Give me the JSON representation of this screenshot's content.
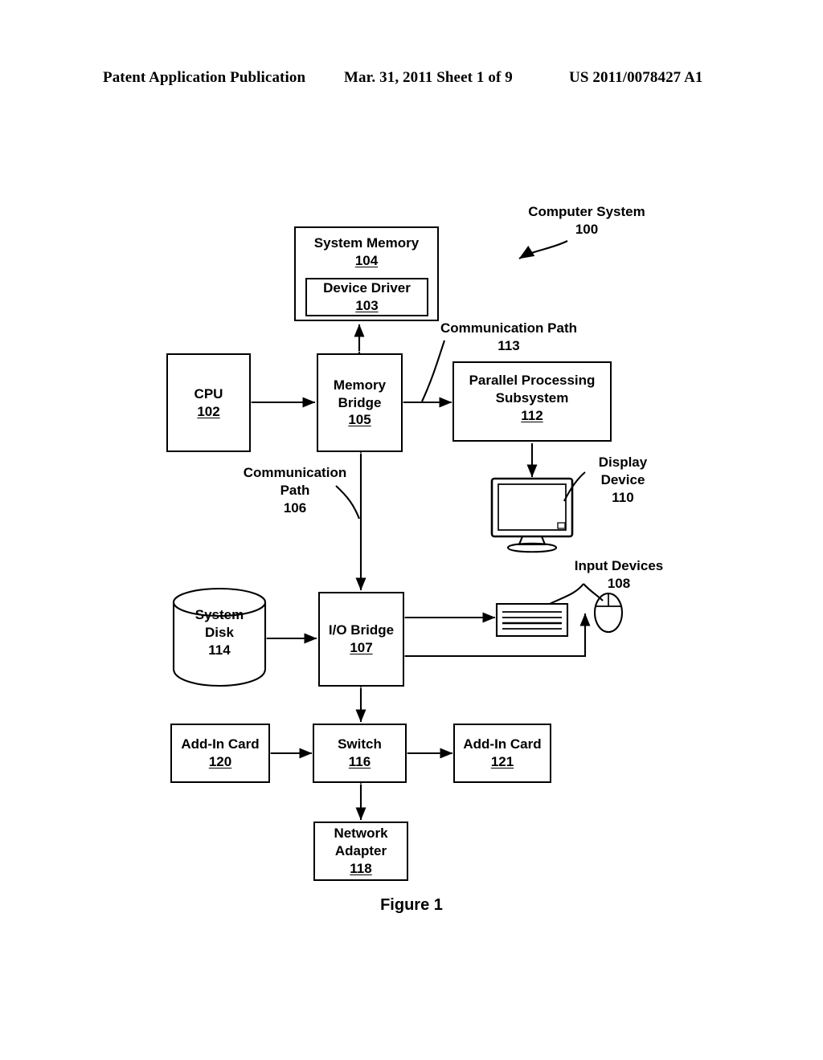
{
  "header": {
    "left": "Patent Application Publication",
    "middle": "Mar. 31, 2011  Sheet 1 of 9",
    "right": "US 2011/0078427 A1"
  },
  "figure": {
    "caption": "Figure 1",
    "title_label": "Computer System",
    "title_ref": "100"
  },
  "boxes": {
    "system_memory": {
      "name": "System Memory",
      "ref": "104"
    },
    "device_driver": {
      "name": "Device Driver",
      "ref": "103"
    },
    "cpu": {
      "name": "CPU",
      "ref": "102"
    },
    "memory_bridge": {
      "name_line1": "Memory",
      "name_line2": "Bridge",
      "ref": "105"
    },
    "parallel_pp": {
      "name_line1": "Parallel Processing",
      "name_line2": "Subsystem",
      "ref": "112"
    },
    "io_bridge": {
      "name": "I/O Bridge",
      "ref": "107"
    },
    "system_disk": {
      "name_line1": "System",
      "name_line2": "Disk",
      "ref": "114"
    },
    "switch": {
      "name": "Switch",
      "ref": "116"
    },
    "add_in_card_120": {
      "name": "Add-In Card",
      "ref": "120"
    },
    "add_in_card_121": {
      "name": "Add-In Card",
      "ref": "121"
    },
    "network_adapter": {
      "name_line1": "Network",
      "name_line2": "Adapter",
      "ref": "118"
    }
  },
  "callouts": {
    "comm_path_113": {
      "line1": "Communication Path",
      "line2": "113"
    },
    "comm_path_106": {
      "line1": "Communication",
      "line2": "Path",
      "line3": "106"
    },
    "display_device": {
      "line1": "Display",
      "line2": "Device",
      "line3": "110"
    },
    "input_devices": {
      "line1": "Input Devices",
      "line2": "108"
    }
  },
  "icons": {
    "display_monitor": "monitor-icon",
    "keyboard": "keyboard-icon",
    "mouse": "mouse-icon",
    "disk_cylinder": "database-cylinder-icon"
  },
  "colors": {
    "ink": "#000000",
    "paper": "#ffffff"
  }
}
